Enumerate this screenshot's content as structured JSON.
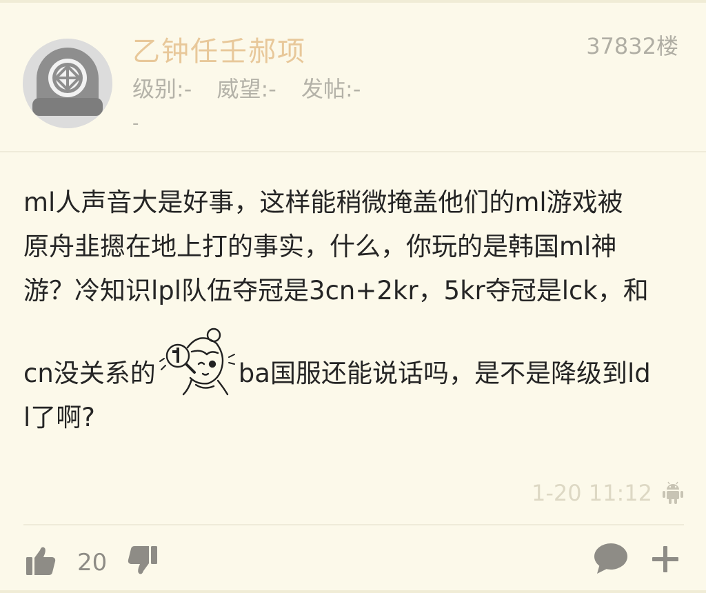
{
  "post": {
    "username": "乙钟任壬郝项",
    "floor": "37832楼",
    "stats": {
      "level": "级别:-",
      "prestige": "威望:-",
      "posts": "发帖:-",
      "extra": "-"
    },
    "content": {
      "line1": "ml人声音大是好事，这样能稍微掩盖他们的ml游戏被",
      "line2": "原舟韭摁在地上打的事实，什么，你玩的是韩国ml神",
      "line3": "游？冷知识lpl队伍夺冠是3cn+2kr，5kr夺冠是lck，和",
      "line4_before": "cn没关系的",
      "line4_after": "ba国服还能说话吗，是不是降级到ld",
      "line5": "l了啊?"
    },
    "timestamp": "1-20 11:12",
    "device_icon": "android-icon",
    "likes": "20"
  },
  "colors": {
    "background": "#fcf9ea",
    "username": "#e8c89a",
    "meta_text": "#b4b2a8",
    "body_text": "#252525",
    "timestamp": "#ddd8c4",
    "icon": "#8e8c86"
  },
  "icons": {
    "avatar": "diving-helmet-avatar",
    "emoji": "anime-girl-magnifier-sticker",
    "like": "thumbs-up-icon",
    "dislike": "thumbs-down-icon",
    "comment": "comment-bubble-icon",
    "add": "plus-icon"
  }
}
